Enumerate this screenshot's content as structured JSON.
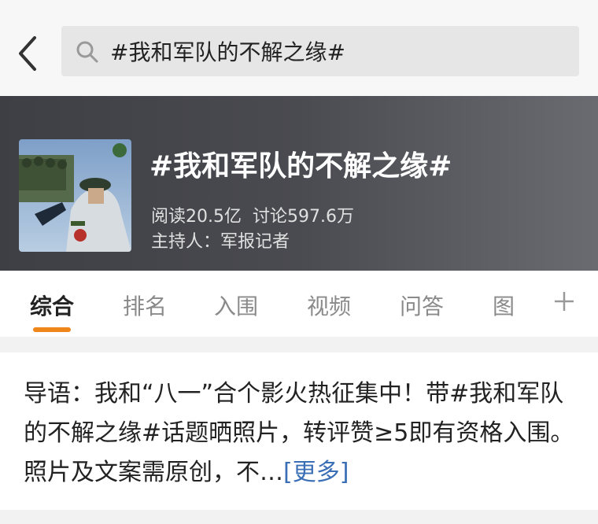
{
  "search": {
    "query": "#我和军队的不解之缘#"
  },
  "banner": {
    "title": "#我和军队的不解之缘#",
    "reads": "阅读20.5亿",
    "discussions": "讨论597.6万",
    "host": "主持人：军报记者"
  },
  "tabs": [
    {
      "label": "综合",
      "active": true
    },
    {
      "label": "排名"
    },
    {
      "label": "入围"
    },
    {
      "label": "视频"
    },
    {
      "label": "问答"
    },
    {
      "label": "图"
    }
  ],
  "intro": {
    "text": "导语：我和“八一”合个影火热征集中！带#我和军队的不解之缘#话题晒照片，转评赞≥5即有资格入围。照片及文案需原创，不…",
    "more_label": "[更多]"
  },
  "colors": {
    "accent": "#f08519",
    "link": "#3a6fb6",
    "banner_bg": "#45464c"
  },
  "icons": [
    "back-arrow-icon",
    "search-icon",
    "plus-icon"
  ]
}
